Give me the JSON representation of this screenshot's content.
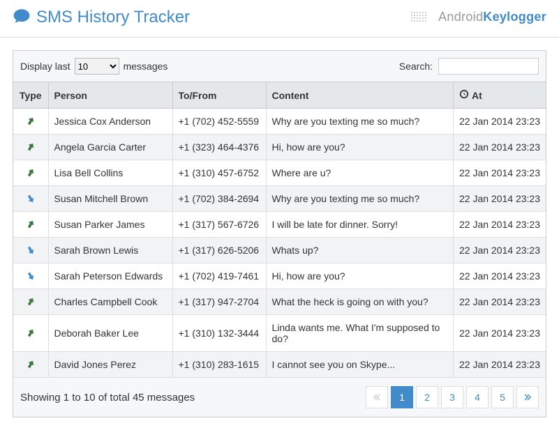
{
  "header": {
    "title": "SMS History Tracker",
    "brand_light": "Android",
    "brand_bold": "Keylogger"
  },
  "toolbar": {
    "display_prefix": "Display last",
    "display_suffix": "messages",
    "page_size_selected": "10",
    "search_label": "Search:",
    "search_value": ""
  },
  "columns": {
    "type": "Type",
    "person": "Person",
    "phone": "To/From",
    "content": "Content",
    "at": "At"
  },
  "rows": [
    {
      "dir": "out",
      "person": "Jessica Cox Anderson",
      "phone": "+1 (702) 452-5559",
      "content": "Why are you texting me so much?",
      "at": "22 Jan 2014 23:23"
    },
    {
      "dir": "out",
      "person": "Angela Garcia Carter",
      "phone": "+1 (323) 464-4376",
      "content": "Hi, how are you?",
      "at": "22 Jan 2014 23:23"
    },
    {
      "dir": "out",
      "person": "Lisa Bell Collins",
      "phone": "+1 (310) 457-6752",
      "content": "Where are u?",
      "at": "22 Jan 2014 23:23"
    },
    {
      "dir": "in",
      "person": "Susan Mitchell Brown",
      "phone": "+1 (702) 384-2694",
      "content": "Why are you texting me so much?",
      "at": "22 Jan 2014 23:23"
    },
    {
      "dir": "out",
      "person": "Susan Parker James",
      "phone": "+1 (317) 567-6726",
      "content": "I will be late for dinner. Sorry!",
      "at": "22 Jan 2014 23:23"
    },
    {
      "dir": "in",
      "person": "Sarah Brown Lewis",
      "phone": "+1 (317) 626-5206",
      "content": "Whats up?",
      "at": "22 Jan 2014 23:23"
    },
    {
      "dir": "in",
      "person": "Sarah Peterson Edwards",
      "phone": "+1 (702) 419-7461",
      "content": "Hi, how are you?",
      "at": "22 Jan 2014 23:23"
    },
    {
      "dir": "out",
      "person": "Charles Campbell Cook",
      "phone": "+1 (317) 947-2704",
      "content": "What the heck is going on with you?",
      "at": "22 Jan 2014 23:23"
    },
    {
      "dir": "out",
      "person": "Deborah Baker Lee",
      "phone": "+1 (310) 132-3444",
      "content": "Linda wants me. What I'm supposed to do?",
      "at": "22 Jan 2014 23:23"
    },
    {
      "dir": "out",
      "person": "David Jones Perez",
      "phone": "+1 (310) 283-1615",
      "content": "I cannot see you on Skype...",
      "at": "22 Jan 2014 23:23"
    }
  ],
  "footer": {
    "summary": "Showing 1 to 10 of total 45 messages"
  },
  "pagination": {
    "pages": [
      "1",
      "2",
      "3",
      "4",
      "5"
    ],
    "active_index": 0
  }
}
